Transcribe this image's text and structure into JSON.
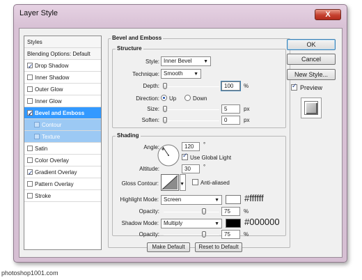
{
  "window": {
    "title": "Layer Style",
    "close_label": "X"
  },
  "styles_list": {
    "header": "Styles",
    "blending": "Blending Options: Default",
    "items": [
      {
        "label": "Drop Shadow",
        "checked": true
      },
      {
        "label": "Inner Shadow",
        "checked": false
      },
      {
        "label": "Outer Glow",
        "checked": false
      },
      {
        "label": "Inner Glow",
        "checked": false
      },
      {
        "label": "Bevel and Emboss",
        "checked": true
      },
      {
        "label": "Contour",
        "checked": false
      },
      {
        "label": "Texture",
        "checked": false
      },
      {
        "label": "Satin",
        "checked": false
      },
      {
        "label": "Color Overlay",
        "checked": false
      },
      {
        "label": "Gradient Overlay",
        "checked": true
      },
      {
        "label": "Pattern Overlay",
        "checked": false
      },
      {
        "label": "Stroke",
        "checked": false
      }
    ]
  },
  "bevel": {
    "title": "Bevel and Emboss",
    "structure": "Structure",
    "style_label": "Style:",
    "style_value": "Inner Bevel",
    "technique_label": "Technique:",
    "technique_value": "Smooth",
    "depth_label": "Depth:",
    "depth_value": "100",
    "percent": "%",
    "direction_label": "Direction:",
    "up_label": "Up",
    "down_label": "Down",
    "size_label": "Size:",
    "size_value": "5",
    "px": "px",
    "soften_label": "Soften:",
    "soften_value": "0"
  },
  "shading": {
    "title": "Shading",
    "angle_label": "Angle:",
    "angle_value": "120",
    "degree": "°",
    "global_light_label": "Use Global Light",
    "altitude_label": "Altitude:",
    "altitude_value": "30",
    "gloss_label": "Gloss Contour:",
    "antialias_label": "Anti-aliased",
    "highlight_label": "Highlight Mode:",
    "highlight_value": "Screen",
    "highlight_color": "#ffffff",
    "highlight_hex": "#ffffff",
    "opacity_label": "Opacity:",
    "highlight_opacity": "75",
    "shadow_label": "Shadow Mode:",
    "shadow_value": "Multiply",
    "shadow_color": "#000000",
    "shadow_hex": "#000000",
    "shadow_opacity": "75"
  },
  "bottom": {
    "make_default": "Make Default",
    "reset_default": "Reset to Default"
  },
  "side": {
    "ok": "OK",
    "cancel": "Cancel",
    "new_style": "New Style...",
    "preview": "Preview"
  },
  "watermark": "photoshop1001.com"
}
